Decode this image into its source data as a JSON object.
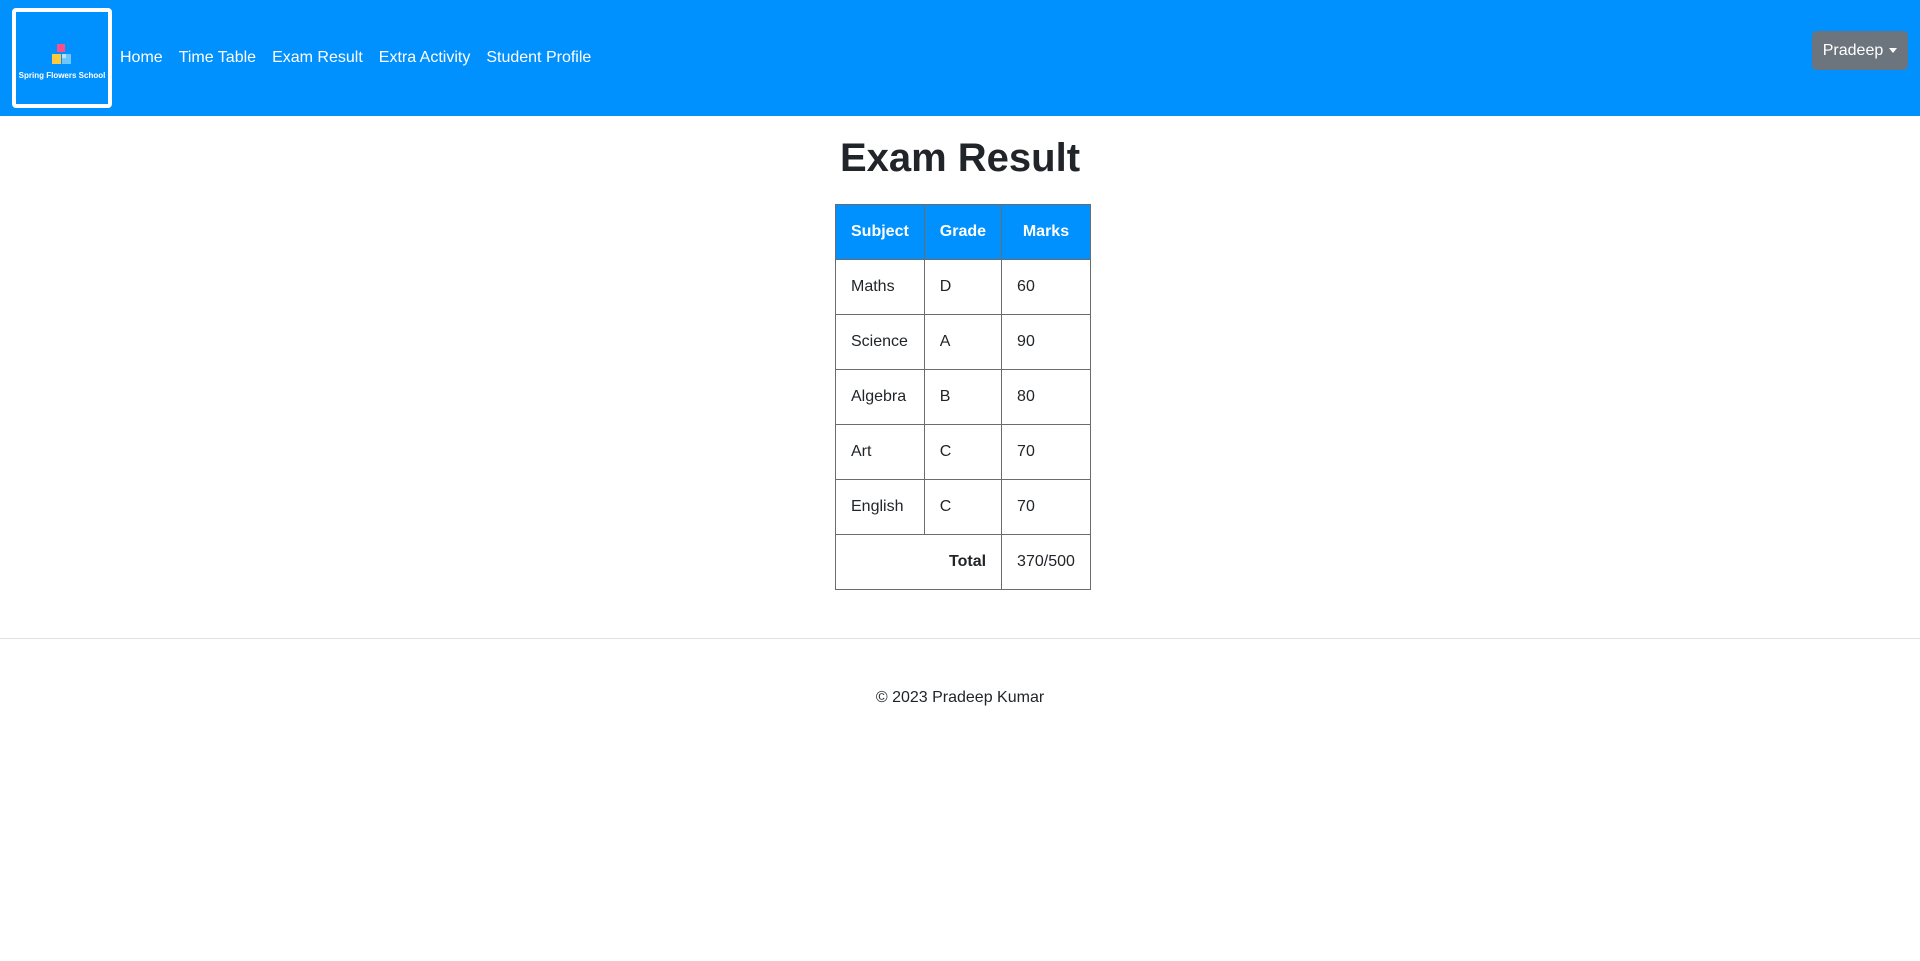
{
  "brand": {
    "name": "Spring Flowers School"
  },
  "nav": {
    "items": [
      {
        "label": "Home"
      },
      {
        "label": "Time Table"
      },
      {
        "label": "Exam Result"
      },
      {
        "label": "Extra Activity"
      },
      {
        "label": "Student Profile"
      }
    ]
  },
  "user": {
    "name": "Pradeep"
  },
  "page": {
    "title": "Exam Result"
  },
  "table": {
    "headers": [
      "Subject",
      "Grade",
      "Marks"
    ],
    "rows": [
      {
        "subject": "Maths",
        "grade": "D",
        "marks": "60"
      },
      {
        "subject": "Science",
        "grade": "A",
        "marks": "90"
      },
      {
        "subject": "Algebra",
        "grade": "B",
        "marks": "80"
      },
      {
        "subject": "Art",
        "grade": "C",
        "marks": "70"
      },
      {
        "subject": "English",
        "grade": "C",
        "marks": "70"
      }
    ],
    "total_label": "Total",
    "total_value": "370/500"
  },
  "footer": {
    "text": "© 2023 Pradeep Kumar"
  },
  "colors": {
    "primary": "#0091ff",
    "secondary": "#6c757d"
  }
}
